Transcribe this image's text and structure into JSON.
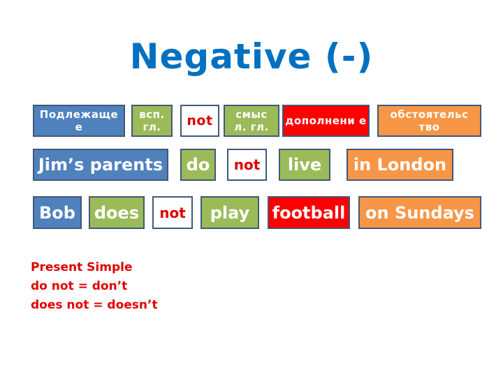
{
  "title": "Negative (-)",
  "colors": {
    "title": "#0070c0",
    "subject": "#4f81bd",
    "verb": "#9bbb59",
    "object": "#ff0000",
    "adverbial": "#f79646",
    "negation_text": "#e00000",
    "border": "#41587a"
  },
  "header_row": [
    {
      "label": "Подлежаще е",
      "role": "subject"
    },
    {
      "label": "всп. гл.",
      "role": "auxiliary"
    },
    {
      "label": "not",
      "role": "negation"
    },
    {
      "label": "смыс л. гл.",
      "role": "main-verb"
    },
    {
      "label": "дополнени е",
      "role": "object"
    },
    {
      "label": "обстоятельс тво",
      "role": "adverbial"
    }
  ],
  "example_1": [
    {
      "label": "Jim’s parents",
      "role": "subject"
    },
    {
      "label": "do",
      "role": "auxiliary"
    },
    {
      "label": "not",
      "role": "negation"
    },
    {
      "label": "live",
      "role": "main-verb"
    },
    {
      "label": "in London",
      "role": "adverbial"
    }
  ],
  "example_2": [
    {
      "label": "Bob",
      "role": "subject"
    },
    {
      "label": "does",
      "role": "auxiliary"
    },
    {
      "label": "not",
      "role": "negation"
    },
    {
      "label": "play",
      "role": "main-verb"
    },
    {
      "label": "football",
      "role": "object"
    },
    {
      "label": "on Sundays",
      "role": "adverbial"
    }
  ],
  "notes": [
    "Present Simple",
    "do not = don’t",
    "does not = doesn’t"
  ]
}
